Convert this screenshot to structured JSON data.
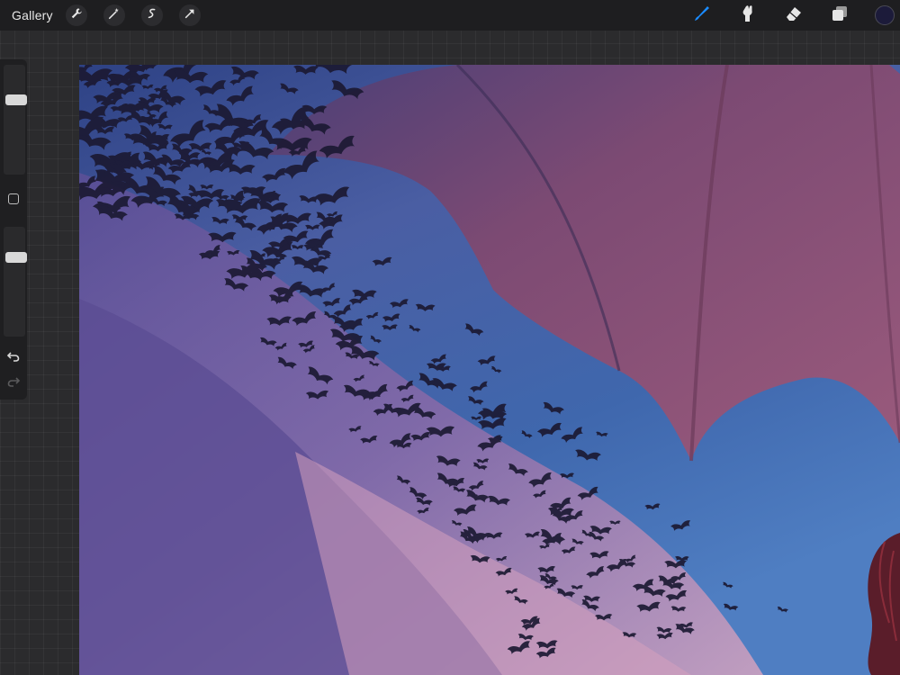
{
  "toolbar": {
    "gallery_label": "Gallery",
    "left_tools": [
      "wrench-icon",
      "magic-wand-icon",
      "selection-icon",
      "transform-arrow-icon"
    ],
    "right_tools": [
      "brush-icon",
      "smudge-icon",
      "eraser-icon",
      "layers-icon"
    ],
    "active_tool": "brush-icon",
    "accent_color": "#1a8cff",
    "current_color": "#1c1b3a"
  },
  "sidebar": {
    "brush_size": 0.7,
    "opacity": 0.75
  },
  "canvas": {
    "subject": "bats-and-dragon-wing-artwork",
    "sky_colors": [
      "#3a4f8f",
      "#6b5fa3",
      "#c49ab8"
    ],
    "wing_color": "#8a4a6e"
  }
}
